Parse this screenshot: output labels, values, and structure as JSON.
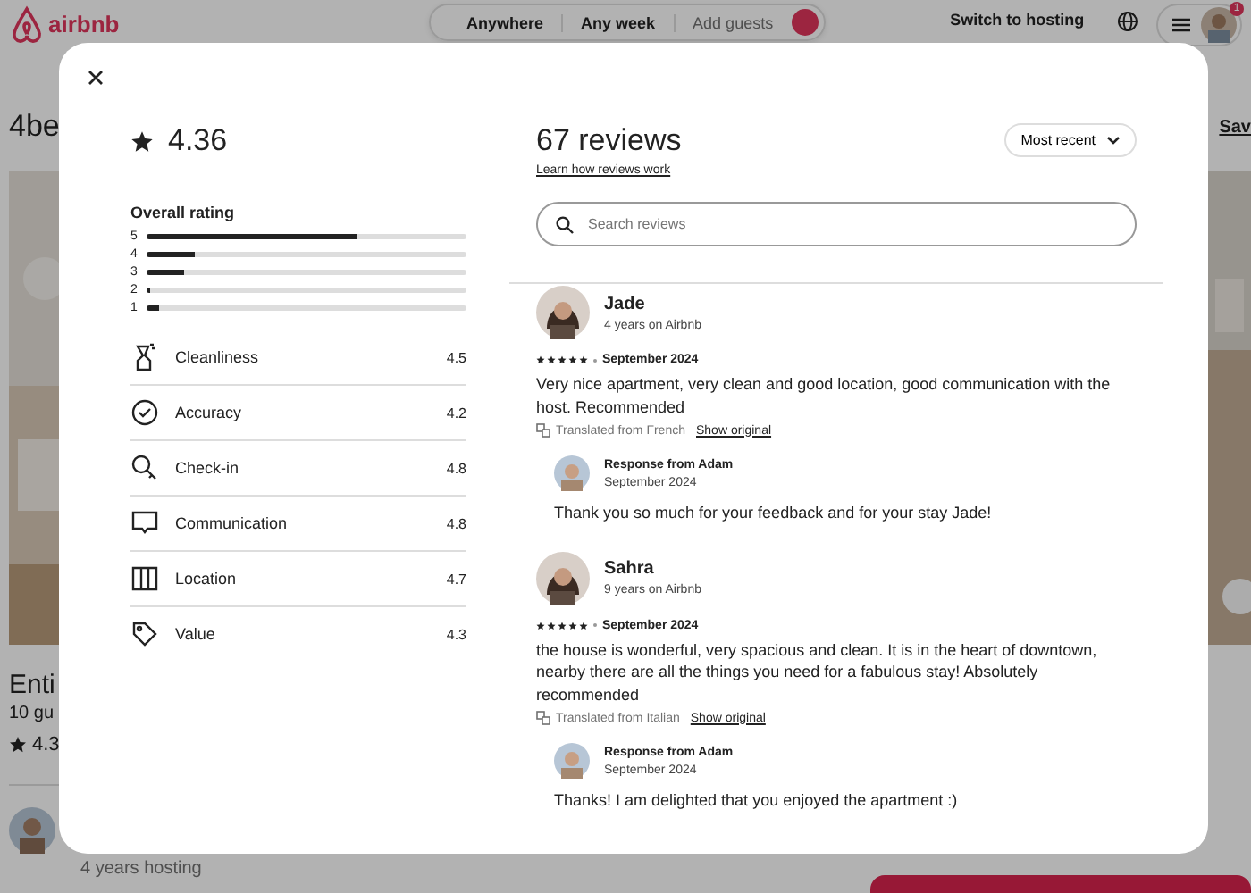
{
  "header": {
    "logo": "airbnb",
    "search": [
      "Anywhere",
      "Any week",
      "Add guests"
    ],
    "host_link": "Switch to hosting",
    "notification_count": "1"
  },
  "listing": {
    "title": "4be",
    "save": "Sav",
    "name": "Enti",
    "guests": "10 gu",
    "rating": "4.3",
    "host_years": "4 years hosting"
  },
  "modal": {
    "rating": "4.36",
    "overall_label": "Overall rating",
    "distribution": [
      {
        "label": "5",
        "level": 0.66
      },
      {
        "label": "4",
        "level": 0.15
      },
      {
        "label": "3",
        "level": 0.12
      },
      {
        "label": "2",
        "level": 0.01
      },
      {
        "label": "1",
        "level": 0.04
      }
    ],
    "categories": [
      {
        "kind": "cleanliness",
        "name": "Cleanliness",
        "score": "4.5"
      },
      {
        "kind": "accuracy",
        "name": "Accuracy",
        "score": "4.2"
      },
      {
        "kind": "checkin",
        "name": "Check-in",
        "score": "4.8"
      },
      {
        "kind": "communication",
        "name": "Communication",
        "score": "4.8"
      },
      {
        "kind": "location",
        "name": "Location",
        "score": "4.7"
      },
      {
        "kind": "value",
        "name": "Value",
        "score": "4.3"
      }
    ],
    "review_count": "67 reviews",
    "learn_link": "Learn how reviews work",
    "sort": "Most recent",
    "search": {
      "placeholder": "Search reviews"
    },
    "reviews": [
      {
        "name": "Jade",
        "tenure": "4 years on Airbnb",
        "stars": 5,
        "date": "September 2024",
        "text": "Very nice apartment, very clean and good location, good communication with the host. Recommended",
        "translation": "Translated from French",
        "show_original": "Show original",
        "response": {
          "title": "Response from Adam",
          "date": "September 2024",
          "text": "Thank you so much for your feedback and for your stay Jade!"
        }
      },
      {
        "name": "Sahra",
        "tenure": "9 years on Airbnb",
        "stars": 5,
        "date": "September 2024",
        "text": "the house is wonderful, very spacious and clean. It is in the heart of downtown, nearby there are all the things you need for a fabulous stay! Absolutely recommended",
        "translation": "Translated from Italian",
        "show_original": "Show original",
        "response": {
          "title": "Response from Adam",
          "date": "September 2024",
          "text": "Thanks! I am delighted that you enjoyed the apartment :)"
        }
      }
    ]
  }
}
